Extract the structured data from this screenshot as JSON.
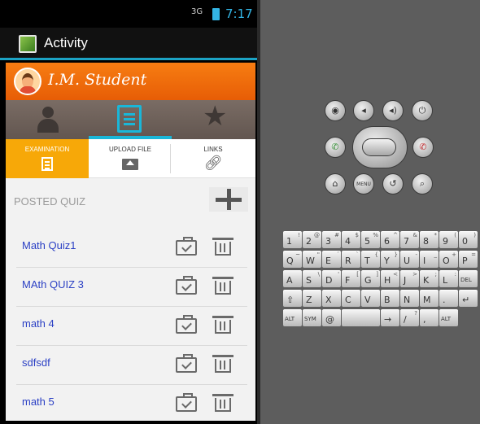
{
  "statusbar": {
    "signal": "3G",
    "time": "7:17"
  },
  "titlebar": {
    "title": "Activity"
  },
  "profile": {
    "name": "I.M. Student"
  },
  "subtabs": [
    {
      "label": "EXAMINATION"
    },
    {
      "label": "UPLOAD FILE"
    },
    {
      "label": "LINKS"
    }
  ],
  "section": {
    "title": "POSTED QUIZ"
  },
  "quizzes": [
    {
      "name": "Math Quiz1"
    },
    {
      "name": "MAth QUIZ 3"
    },
    {
      "name": "math 4"
    },
    {
      "name": "sdfsdf"
    },
    {
      "name": "math 5"
    }
  ],
  "emulator": {
    "menu_label": "MENU"
  },
  "keyboard": {
    "row1": [
      [
        "1",
        "!"
      ],
      [
        "2",
        "@"
      ],
      [
        "3",
        "#"
      ],
      [
        "4",
        "$"
      ],
      [
        "5",
        "%"
      ],
      [
        "6",
        "^"
      ],
      [
        "7",
        "&"
      ],
      [
        "8",
        "*"
      ],
      [
        "9",
        "("
      ],
      [
        "0",
        ")"
      ]
    ],
    "row2": [
      [
        "Q",
        "~"
      ],
      [
        "W",
        "\""
      ],
      [
        "E",
        "´"
      ],
      [
        "R",
        "`"
      ],
      [
        "T",
        "{"
      ],
      [
        "Y",
        "}"
      ],
      [
        "U",
        "-"
      ],
      [
        "I",
        "_"
      ],
      [
        "O",
        "+"
      ],
      [
        "P",
        "="
      ]
    ],
    "row3": [
      [
        "A",
        ""
      ],
      [
        "S",
        "\\"
      ],
      [
        "D",
        "'"
      ],
      [
        "F",
        "["
      ],
      [
        "G",
        "]"
      ],
      [
        "H",
        "<"
      ],
      [
        "J",
        ">"
      ],
      [
        "K",
        ";"
      ],
      [
        "L",
        ":"
      ],
      [
        "DEL",
        ""
      ]
    ],
    "row4": [
      [
        "⇧",
        ""
      ],
      [
        "Z",
        ""
      ],
      [
        "X",
        ""
      ],
      [
        "C",
        ""
      ],
      [
        "V",
        ""
      ],
      [
        "B",
        ""
      ],
      [
        "N",
        ""
      ],
      [
        "M",
        ""
      ],
      [
        ".",
        ""
      ],
      [
        "↵",
        ""
      ]
    ],
    "row5": [
      [
        "ALT",
        ""
      ],
      [
        "SYM",
        ""
      ],
      [
        "@",
        ""
      ],
      [
        "",
        ""
      ],
      [
        "",
        ""
      ],
      [
        "→",
        ""
      ],
      [
        "/",
        "?"
      ],
      [
        ",",
        ""
      ],
      [
        "ALT",
        ""
      ]
    ]
  }
}
